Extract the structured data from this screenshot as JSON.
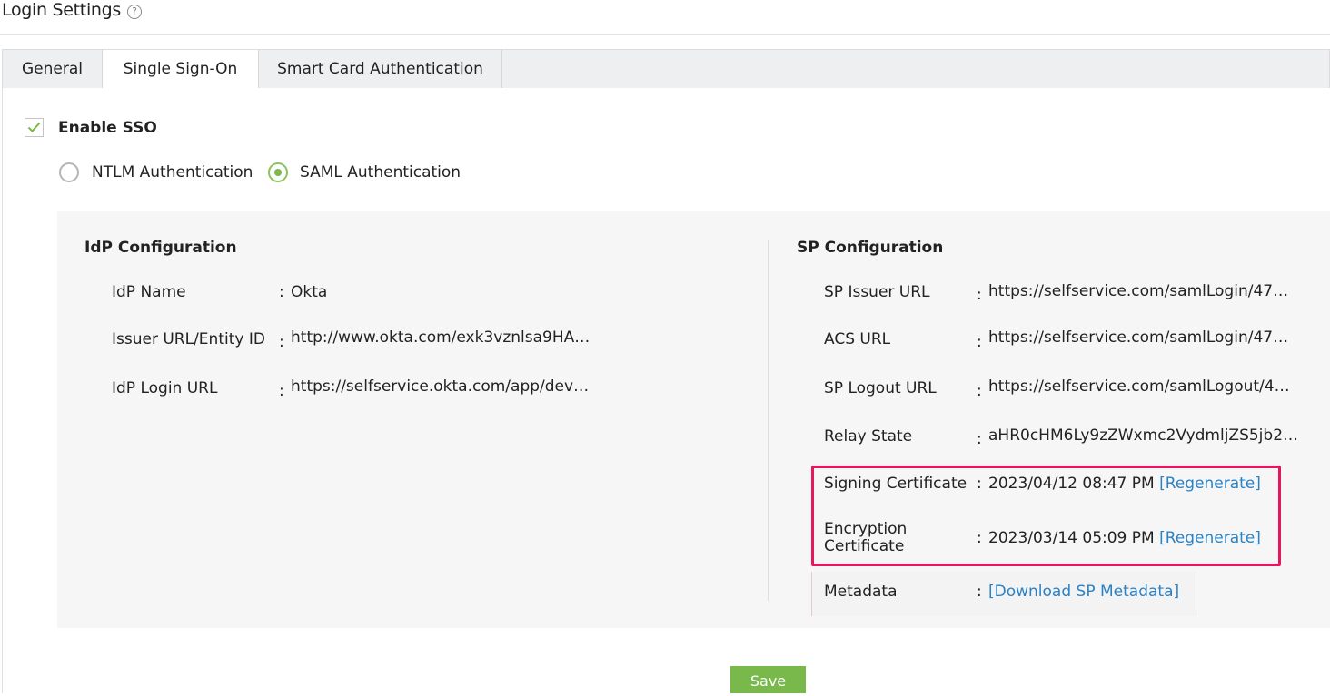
{
  "header": {
    "title": "Login Settings",
    "help_icon": "question-circle-icon"
  },
  "tabs": [
    {
      "label": "General",
      "active": false
    },
    {
      "label": "Single Sign-On",
      "active": true
    },
    {
      "label": "Smart Card Authentication",
      "active": false
    }
  ],
  "sso": {
    "enable_label": "Enable SSO",
    "enabled": true,
    "auth_options": [
      {
        "label": "NTLM Authentication",
        "selected": false
      },
      {
        "label": "SAML Authentication",
        "selected": true
      }
    ]
  },
  "idp": {
    "title": "IdP Configuration",
    "fields": [
      {
        "label": "IdP Name",
        "value": "Okta"
      },
      {
        "label": "Issuer URL/Entity ID",
        "value": "http://www.okta.com/exk3vznlsa9HA…"
      },
      {
        "label": "IdP Login URL",
        "value": "https://selfservice.okta.com/app/dev…"
      }
    ]
  },
  "sp": {
    "title": "SP Configuration",
    "fields": [
      {
        "label": "SP Issuer URL",
        "value": "https://selfservice.com/samlLogin/47…"
      },
      {
        "label": "ACS URL",
        "value": "https://selfservice.com/samlLogin/47…"
      },
      {
        "label": "SP Logout URL",
        "value": "https://selfservice.com/samlLogout/4…"
      },
      {
        "label": "Relay State",
        "value": "aHR0cHM6Ly9zZWxmc2VydmljZS5jb2…"
      }
    ],
    "certificates": [
      {
        "label_line1": "Signing Certificate",
        "label_line2": "",
        "value": "2023/04/12 08:47 PM",
        "action": "[Regenerate]"
      },
      {
        "label_line1": "Encryption",
        "label_line2": "Certificate",
        "value": "2023/03/14 05:09 PM",
        "action": "[Regenerate]"
      }
    ],
    "metadata": {
      "label": "Metadata",
      "action": "[Download SP Metadata]"
    }
  },
  "colon": ":",
  "save_label": "Save",
  "colors": {
    "accent_green": "#79b94b",
    "link_blue": "#2a82c6",
    "highlight": "#e3185f"
  }
}
